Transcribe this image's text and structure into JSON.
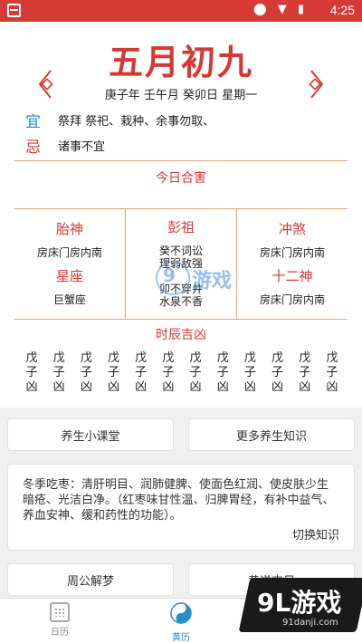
{
  "status_bar": {
    "time": "4:25",
    "icons": "⬤ ▼ ▮"
  },
  "header": {
    "lunar_date": "五月初九",
    "ganzhi_line": "庚子年 壬午月 癸卯日 星期一"
  },
  "yiji": {
    "yi_label": "宜",
    "yi_text": "祭拜 祭祀、栽种、余事勿取、",
    "ji_label": "忌",
    "ji_text": "诸事不宜"
  },
  "today_harm": {
    "title": "今日合害"
  },
  "grid": {
    "taishen_title": "胎神",
    "taishen_text": "房床门房内南",
    "xingzuo_title": "星座",
    "xingzuo_text": "巨蟹座",
    "pengzu_title": "彭祖",
    "pengzu_line1": "癸不词讼",
    "pengzu_line2": "理弱敌强",
    "pengzu_line3": "卯不穿井",
    "pengzu_line4": "水泉不香",
    "chongsha_title": "冲煞",
    "chongsha_text": "房床门房内南",
    "shiershen_title": "十二神",
    "shiershen_text": "房床门房内南"
  },
  "shichen": {
    "title": "时辰吉凶",
    "items": [
      {
        "top": "戊",
        "mid": "子",
        "bot": "凶"
      },
      {
        "top": "戊",
        "mid": "子",
        "bot": "凶"
      },
      {
        "top": "戊",
        "mid": "子",
        "bot": "凶"
      },
      {
        "top": "戊",
        "mid": "子",
        "bot": "凶"
      },
      {
        "top": "戊",
        "mid": "子",
        "bot": "凶"
      },
      {
        "top": "戊",
        "mid": "子",
        "bot": "凶"
      },
      {
        "top": "戊",
        "mid": "子",
        "bot": "凶"
      },
      {
        "top": "戊",
        "mid": "子",
        "bot": "凶"
      },
      {
        "top": "戊",
        "mid": "子",
        "bot": "凶"
      },
      {
        "top": "戊",
        "mid": "子",
        "bot": "凶"
      },
      {
        "top": "戊",
        "mid": "子",
        "bot": "凶"
      },
      {
        "top": "戊",
        "mid": "子",
        "bot": "凶"
      }
    ]
  },
  "buttons": {
    "health_class": "养生小课堂",
    "more_health": "更多养生知识",
    "zhougong": "周公解梦",
    "huangdao": "黄道吉日"
  },
  "knowledge": {
    "text": "冬季吃枣：清肝明目、润肺健脾、使面色红润、使皮肤少生暗疮、光洁白净。（红枣味甘性温、归脾胃经，有补中益气、养血安神、缓和药性的功能）。",
    "switch_label": "切换知识"
  },
  "bottom_nav": {
    "calendar_label": "日历",
    "huangli_label": "黄历"
  },
  "watermarks": {
    "mid_num": "9",
    "mid_text": "游戏",
    "corner_main": "9L游戏",
    "corner_url": "91danji.com"
  },
  "colors": {
    "accent_red": "#d43a33",
    "accent_blue": "#2a8fc7",
    "status_bar": "#d63a35",
    "divider": "#e8a27a"
  }
}
